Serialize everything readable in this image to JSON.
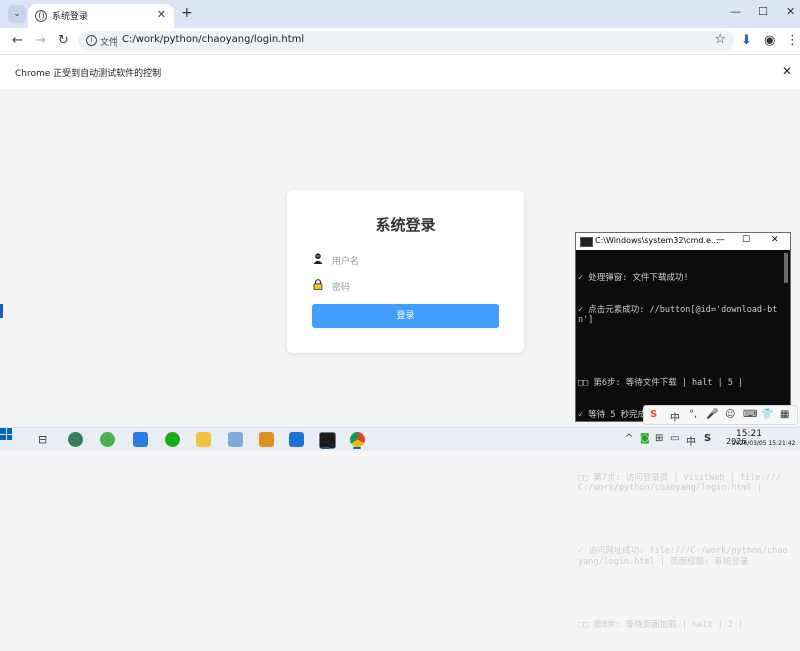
{
  "browser": {
    "tab_title": "系统登录",
    "new_tab": "+",
    "tab_close": "✕",
    "window_controls": {
      "minimize": "—",
      "maximize": "☐",
      "close": "✕"
    },
    "nav": {
      "back": "←",
      "forward": "→",
      "reload": "↻"
    },
    "address": {
      "info": "i",
      "scheme_label": "文件",
      "url": "C:/work/python/chaoyang/login.html"
    },
    "bookmark_star": "☆",
    "download_icon": "⬇",
    "profile_icon": "◉",
    "menu_icon": "⋮",
    "infobar_text": "Chrome 正受到自动测试软件的控制",
    "infobar_close": "✕"
  },
  "login": {
    "title": "系统登录",
    "username_placeholder": "用户名",
    "password_placeholder": "密码",
    "submit_label": "登录"
  },
  "cmd": {
    "title": "C:\\Windows\\system32\\cmd.e...",
    "lines": [
      "✓ 处理弹窗: 文件下载成功!",
      "✓ 点击元素成功: //button[@id='download-btn']",
      "",
      "□□ 第6步: 等待文件下载 | halt | 5 |",
      "✓ 等待 5 秒完成",
      "",
      "□□ 第7步: 访问登录页 | visitWeb | file:///C:/work/python/chaoyang/login.html |",
      "",
      "✓ 访问网址成功: file:///C:/work/python/chaoyang/login.html | 页面标题: 系统登录",
      "",
      "□□ 第8步: 等待页面加载 | halt | 2 |"
    ]
  },
  "ime": {
    "logo": "S",
    "mode": "中",
    "punct": "°,",
    "mic": "🎤",
    "emoji": "☺",
    "keyboard": "⌨",
    "skin": "👕",
    "toolbox": "▦"
  },
  "taskbar": {
    "clock_time": "15:21",
    "clock_year": "2026",
    "clock_date": "2026/03/05 15:21:42",
    "tray_up": "^",
    "tray_ime": "中"
  },
  "colors": {
    "login_button": "#409eff",
    "cmd_background": "#0c0c0c",
    "tabstrip": "#dbe5f5"
  }
}
